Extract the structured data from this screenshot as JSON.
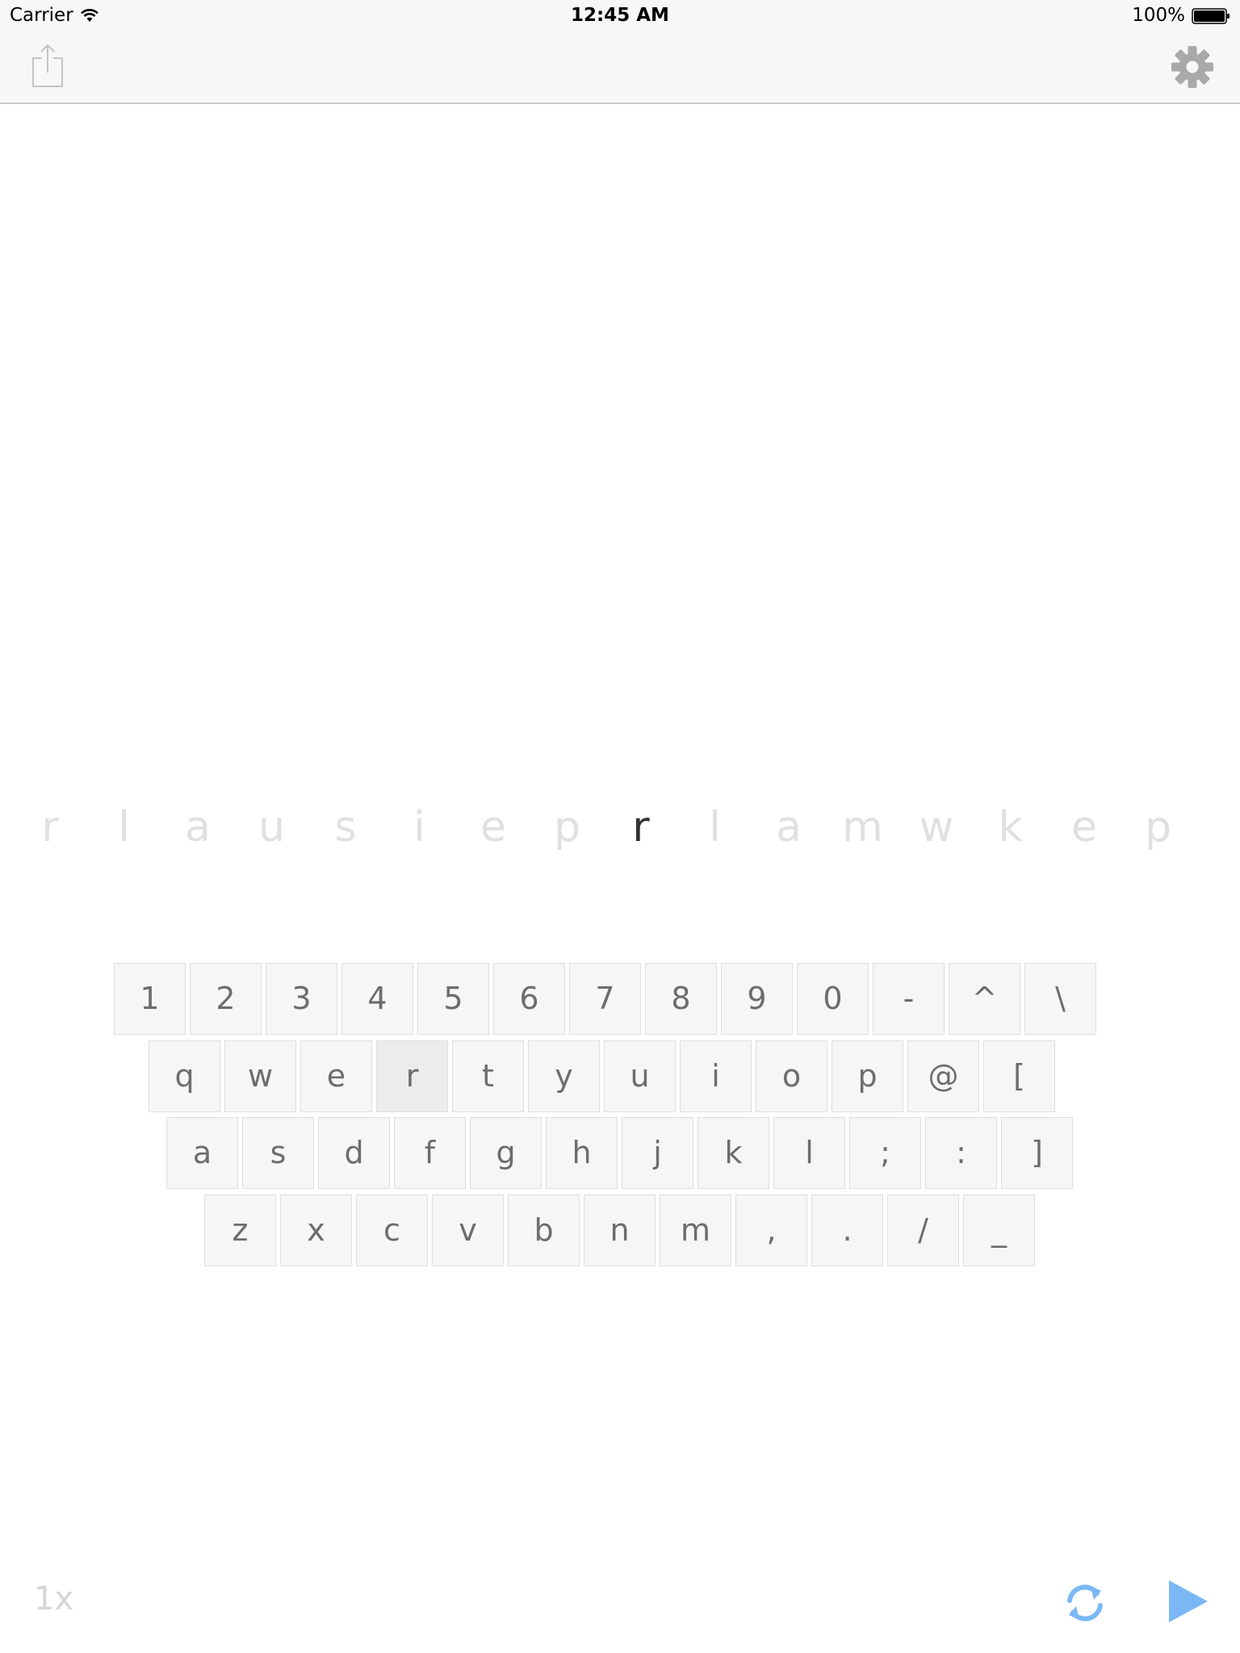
{
  "status_bar": {
    "carrier": "Carrier",
    "time": "12:45 AM",
    "battery_percent": "100%"
  },
  "toolbar": {
    "share_icon": "share-icon",
    "settings_icon": "gear-icon"
  },
  "letter_strip": {
    "letters": [
      "r",
      "l",
      "a",
      "u",
      "s",
      "i",
      "e",
      "p",
      "r",
      "l",
      "a",
      "m",
      "w",
      "k",
      "e",
      "p"
    ],
    "current_index": 8
  },
  "keyboard": {
    "rows": [
      [
        "1",
        "2",
        "3",
        "4",
        "5",
        "6",
        "7",
        "8",
        "9",
        "0",
        "-",
        "^",
        "\\"
      ],
      [
        "q",
        "w",
        "e",
        "r",
        "t",
        "y",
        "u",
        "i",
        "o",
        "p",
        "@",
        "["
      ],
      [
        "a",
        "s",
        "d",
        "f",
        "g",
        "h",
        "j",
        "k",
        "l",
        ";",
        ":",
        "]"
      ],
      [
        "z",
        "x",
        "c",
        "v",
        "b",
        "n",
        "m",
        ",",
        ".",
        "/",
        "_"
      ]
    ],
    "highlighted_key": "r"
  },
  "bottom": {
    "speed": "1x",
    "refresh_icon": "refresh-icon",
    "play_icon": "play-icon"
  },
  "colors": {
    "accent": "#7ab8f5",
    "key_text": "#6d6d6d",
    "strip_faded": "#e0e0e0",
    "strip_current": "#333333"
  }
}
